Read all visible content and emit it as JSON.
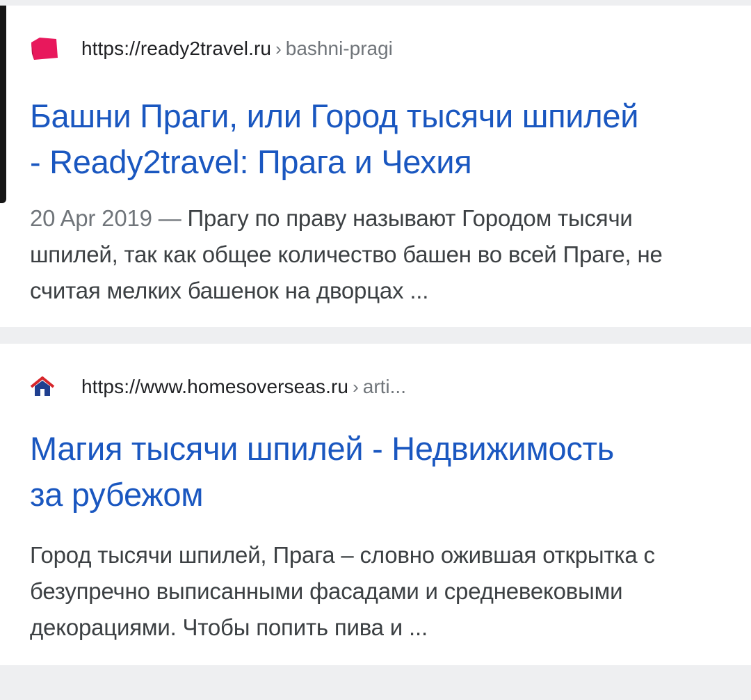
{
  "results": [
    {
      "favicon": "ready2travel-pink-tag-icon",
      "url_host": "https://ready2travel.ru",
      "url_separator": "›",
      "url_path": "bashni-pragi",
      "title_line1": "Башни Праги, или Город тысячи шпилей",
      "title_line2": "- Ready2travel: Прага и Чехия",
      "date": "20 Apr 2019 —",
      "snippet": "Прагу по праву называют Городом тысячи шпилей, так как общее количество башен во всей Праге, не считая мелких башенок на дворцах ..."
    },
    {
      "favicon": "house-icon",
      "url_host": "https://www.homesoverseas.ru",
      "url_separator": "›",
      "url_path": "arti...",
      "title_line1": "Магия тысячи шпилей - Недвижимость",
      "title_line2": "за рубежом",
      "snippet": "Город тысячи шпилей, Прага – словно ожившая открытка с безупречно выписанными фасадами и средневековыми декорациями. Чтобы попить пива и  ..."
    }
  ],
  "colors": {
    "title_link": "#1a57c0",
    "url_host": "#202124",
    "url_path": "#70757a",
    "snippet": "#3c4043",
    "background": "#eeeff1",
    "card": "#ffffff",
    "favicon_pink": "#e8185c",
    "favicon_house_roof": "#d7262b",
    "favicon_house_body": "#1f3f8f"
  }
}
